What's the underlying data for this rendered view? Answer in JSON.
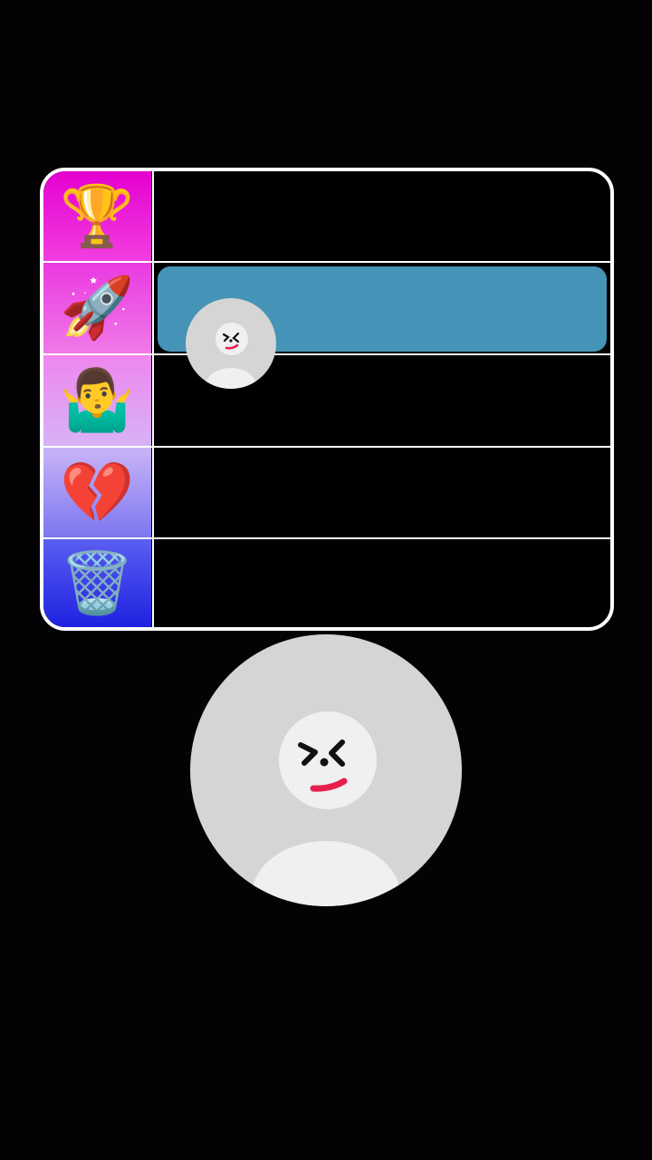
{
  "tier_list": {
    "tiers": [
      {
        "icon": "🏆",
        "icon_name": "trophy-icon",
        "gradient": [
          "#e400d0",
          "#f23fe0"
        ]
      },
      {
        "icon": "🚀",
        "icon_name": "rocket-icon",
        "gradient": [
          "#ea39e0",
          "#f07ae8"
        ]
      },
      {
        "icon": "🤷‍♂️",
        "icon_name": "shrug-icon",
        "gradient": [
          "#ee86ee",
          "#d7b2f6"
        ]
      },
      {
        "icon": "💔",
        "icon_name": "broken-heart-icon",
        "gradient": [
          "#c9b4f7",
          "#7b76f0"
        ]
      },
      {
        "icon": "🗑️",
        "icon_name": "trash-icon",
        "gradient": [
          "#5a5ef0",
          "#1e22e0"
        ]
      }
    ],
    "highlighted_tier_index": 1,
    "highlight_color": "#4593b6"
  },
  "colors": {
    "background": "#050205",
    "border": "#ffffff",
    "avatar_bg": "#d5d5d5",
    "avatar_face": "#f0f0f0",
    "mouth": "#e5204e"
  }
}
